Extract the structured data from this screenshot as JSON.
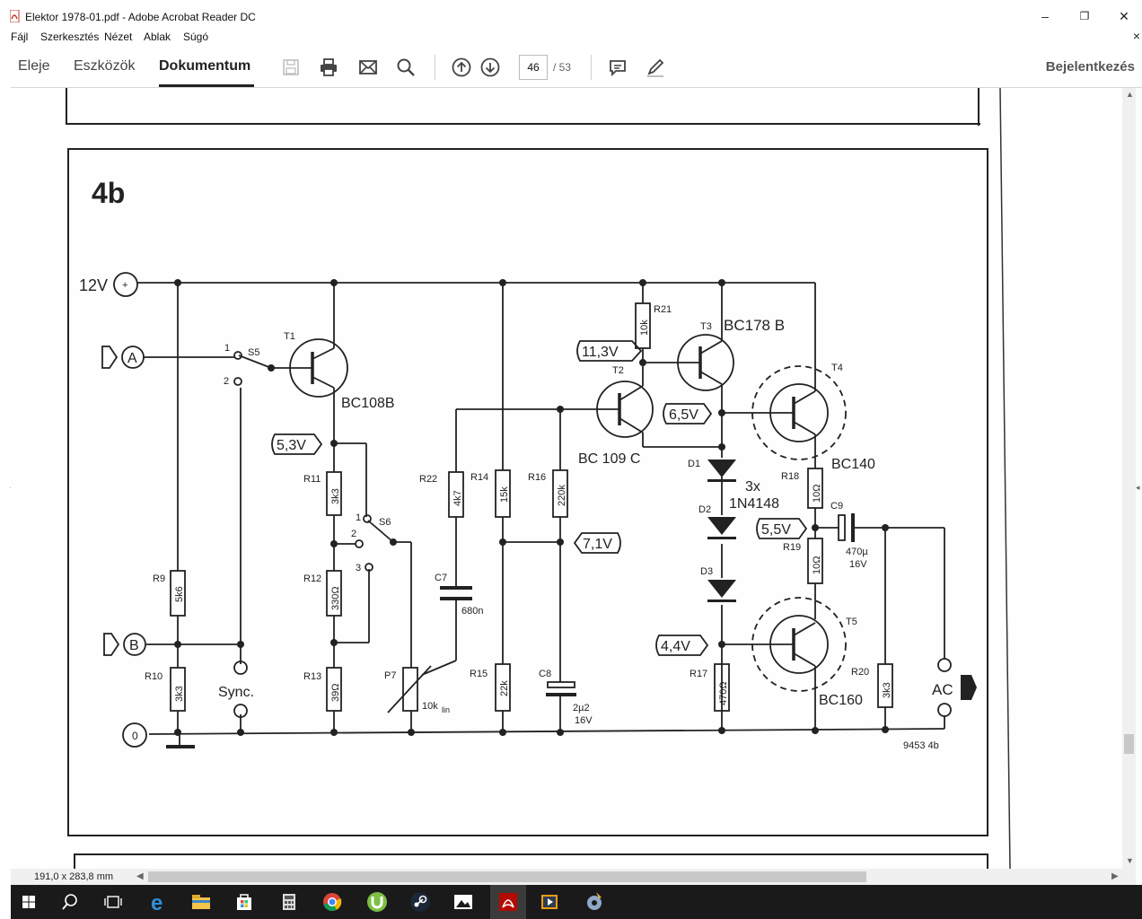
{
  "window": {
    "title": "Elektor 1978-01.pdf - Adobe Acrobat Reader DC",
    "minimize": "–",
    "restore": "❐",
    "close": "✕"
  },
  "menu": {
    "items": [
      "Fájl",
      "Szerkesztés",
      "Nézet",
      "Ablak",
      "Súgó"
    ],
    "close_doc": "×"
  },
  "toolbar": {
    "tabs": [
      "Eleje",
      "Eszközök",
      "Dokumentum"
    ],
    "active_tab": "Dokumentum",
    "page_current": "46",
    "page_total": "/ 53",
    "sign_in": "Bejelentkezés"
  },
  "status": {
    "dimensions": "191,0 x 283,8 mm"
  },
  "schematic": {
    "figure": "4b",
    "code": "9453 4b",
    "supply": "12V",
    "ground": "0",
    "inputs": [
      "A",
      "B"
    ],
    "sync": "Sync.",
    "output": "AC",
    "voltages": [
      "11,3V",
      "6,5V",
      "5,3V",
      "7,1V",
      "5,5V",
      "4,4V"
    ],
    "transistors": [
      {
        "ref": "T1",
        "type": "BC108B"
      },
      {
        "ref": "T2",
        "type": "BC 109 C"
      },
      {
        "ref": "T3",
        "type": "BC178 B"
      },
      {
        "ref": "T4",
        "type": "BC140"
      },
      {
        "ref": "T5",
        "type": "BC160"
      }
    ],
    "resistors": [
      {
        "ref": "R9",
        "value": "5k6"
      },
      {
        "ref": "R10",
        "value": "3k3"
      },
      {
        "ref": "R11",
        "value": "3k3"
      },
      {
        "ref": "R12",
        "value": "330Ω"
      },
      {
        "ref": "R13",
        "value": "39Ω"
      },
      {
        "ref": "R14",
        "value": "15k"
      },
      {
        "ref": "R15",
        "value": "22k"
      },
      {
        "ref": "R16",
        "value": "220k"
      },
      {
        "ref": "R17",
        "value": "470Ω"
      },
      {
        "ref": "R18",
        "value": "10Ω"
      },
      {
        "ref": "R19",
        "value": "10Ω"
      },
      {
        "ref": "R20",
        "value": "3k3"
      },
      {
        "ref": "R21",
        "value": "10k"
      },
      {
        "ref": "R22",
        "value": "4k7"
      }
    ],
    "capacitors": [
      {
        "ref": "C7",
        "value": "680n"
      },
      {
        "ref": "C8",
        "value": "2µ2",
        "voltage": "16V"
      },
      {
        "ref": "C9",
        "value": "470µ",
        "voltage": "16V"
      }
    ],
    "diodes": {
      "refs": [
        "D1",
        "D2",
        "D3"
      ],
      "count": "3x",
      "type": "1N4148"
    },
    "switches": {
      "S5": "S5",
      "S6": "S6",
      "pos1": "1",
      "pos2": "2",
      "pos3": "3"
    },
    "pot": {
      "ref": "P7",
      "value": "10k",
      "suffix": "lin"
    }
  },
  "icons": [
    "save-icon",
    "print-icon",
    "email-icon",
    "search-icon",
    "page-up-icon",
    "page-down-icon",
    "comment-icon",
    "pen-icon"
  ]
}
